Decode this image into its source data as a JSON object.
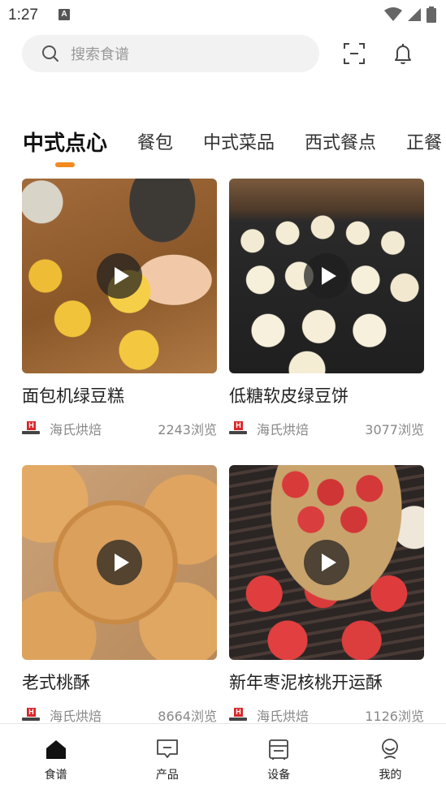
{
  "status_bar": {
    "time": "1:27",
    "notification_glyph": "A"
  },
  "search": {
    "placeholder": "搜索食谱"
  },
  "tabs": [
    {
      "label": "中式点心",
      "active": true
    },
    {
      "label": "餐包",
      "active": false
    },
    {
      "label": "中式菜品",
      "active": false
    },
    {
      "label": "西式餐点",
      "active": false
    },
    {
      "label": "正餐",
      "active": false
    }
  ],
  "recipes": [
    {
      "title": "面包机绿豆糕",
      "author": "海氏烘焙",
      "views": "2243浏览",
      "brand_badge": "H"
    },
    {
      "title": "低糖软皮绿豆饼",
      "author": "海氏烘焙",
      "views": "3077浏览",
      "brand_badge": "H"
    },
    {
      "title": "老式桃酥",
      "author": "海氏烘焙",
      "views": "8664浏览",
      "brand_badge": "H"
    },
    {
      "title": "新年枣泥核桃开运酥",
      "author": "海氏烘焙",
      "views": "1126浏览",
      "brand_badge": "H"
    }
  ],
  "bottom_nav": [
    {
      "label": "食谱",
      "icon": "home-icon",
      "active": true
    },
    {
      "label": "产品",
      "icon": "message-box-icon",
      "active": false
    },
    {
      "label": "设备",
      "icon": "device-icon",
      "active": false
    },
    {
      "label": "我的",
      "icon": "profile-icon",
      "active": false
    }
  ],
  "colors": {
    "accent": "#f28a1d",
    "brand_red": "#d8282c"
  }
}
